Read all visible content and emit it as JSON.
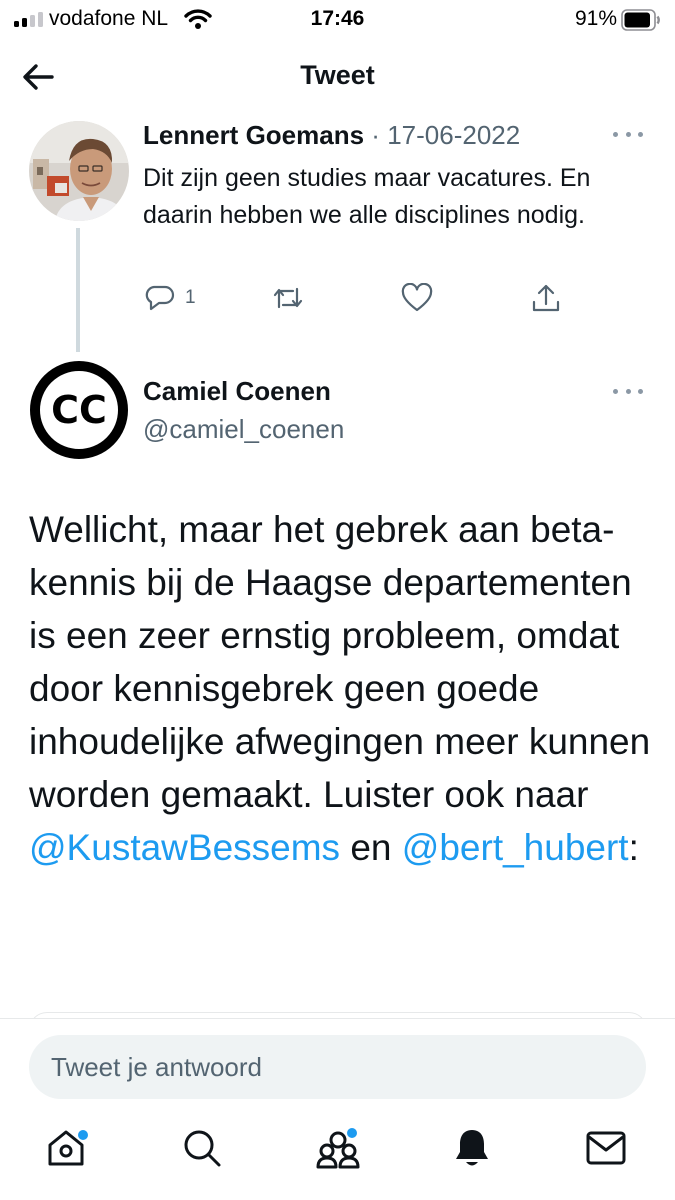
{
  "status_bar": {
    "carrier": "vodafone NL",
    "time": "17:46",
    "battery": "91%",
    "battery_level": 0.91,
    "signal_bars_active": 2,
    "signal_bars_total": 4,
    "icons": [
      "signal-icon",
      "wifi-icon",
      "battery-icon"
    ]
  },
  "nav": {
    "title": "Tweet",
    "back_icon": "arrow-left-icon"
  },
  "parent_tweet": {
    "author_name": "Lennert Goemans",
    "separator": "·",
    "date": "17-06-2022",
    "text": "Dit zijn geen studies maar vacatures. En daarin hebben we alle disciplines nodig.",
    "reply_count": "1",
    "actions": [
      "reply-icon",
      "retweet-icon",
      "like-icon",
      "share-icon"
    ]
  },
  "main_tweet": {
    "author_name": "Camiel Coenen",
    "handle": "@camiel_coenen",
    "avatar_text": "CC",
    "text_before": "Wellicht, maar het gebrek aan beta-kennis bij de Haagse departementen is een zeer ernstig probleem, omdat door kennisgebrek geen goede inhoudelijke afwegingen meer kunnen worden gemaakt. Luister ook naar ",
    "mention_1": "@KustawBessems",
    "text_between": " en ",
    "mention_2": "@bert_hubert",
    "text_after": ":"
  },
  "reply": {
    "placeholder": "Tweet je antwoord"
  },
  "tab_bar": {
    "items": [
      {
        "name": "home",
        "icon": "home-icon",
        "has_dot": true
      },
      {
        "name": "search",
        "icon": "search-icon",
        "has_dot": false
      },
      {
        "name": "communities",
        "icon": "communities-icon",
        "has_dot": true
      },
      {
        "name": "notifications",
        "icon": "bell-icon",
        "has_dot": false
      },
      {
        "name": "messages",
        "icon": "mail-icon",
        "has_dot": false
      }
    ]
  },
  "colors": {
    "accent": "#1d9bf0",
    "text": "#0f1419",
    "secondary": "#536471",
    "border": "#e7e9ea"
  }
}
